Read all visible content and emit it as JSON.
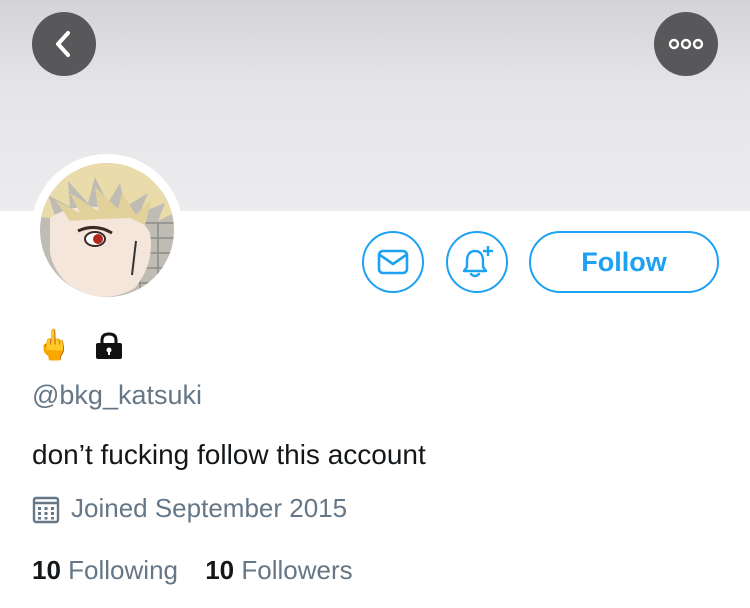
{
  "profile": {
    "handle": "@bkg_katsuki",
    "display_name_emoji": "🖕",
    "protected": true,
    "bio": "don’t fucking follow this account",
    "joined": "Joined September 2015"
  },
  "actions": {
    "follow_label": "Follow"
  },
  "stats": {
    "following_count": "10",
    "following_label": "Following",
    "followers_count": "10",
    "followers_label": "Followers"
  },
  "icons": {
    "back": "chevron-left-icon",
    "more": "more-dots-icon",
    "message": "envelope-icon",
    "notifications": "bell-plus-icon",
    "protected": "lock-icon",
    "joined": "calendar-icon"
  },
  "colors": {
    "accent": "#1da1f2",
    "secondary_text": "#657786",
    "banner": "#ececee",
    "nav_button": "#58585a"
  }
}
